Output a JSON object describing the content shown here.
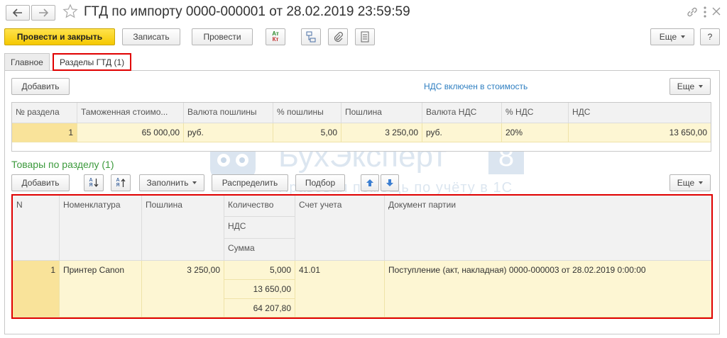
{
  "header": {
    "title": "ГТД по импорту 0000-000001 от 28.02.2019 23:59:59"
  },
  "toolbar": {
    "post_close": "Провести и закрыть",
    "save": "Записать",
    "post": "Провести",
    "dtkt_top": "Ат",
    "dtkt_bottom": "Кт",
    "more": "Еще",
    "help": "?"
  },
  "tabs": [
    {
      "label": "Главное"
    },
    {
      "label": "Разделы ГТД (1)"
    }
  ],
  "sections": {
    "add": "Добавить",
    "vat_link": "НДС включен в стоимость",
    "more": "Еще",
    "columns": [
      "№ раздела",
      "Таможенная стоимо...",
      "Валюта пошлины",
      "% пошлины",
      "Пошлина",
      "Валюта НДС",
      "% НДС",
      "НДС"
    ],
    "rows": [
      [
        "1",
        "65 000,00",
        "руб.",
        "5,00",
        "3 250,00",
        "руб.",
        "20%",
        "13 650,00"
      ]
    ]
  },
  "goods": {
    "title": "Товары по разделу (1)",
    "add": "Добавить",
    "sort_label": "АЯ",
    "fill": "Заполнить",
    "distribute": "Распределить",
    "pick": "Подбор",
    "more": "Еще",
    "columns": {
      "n": "N",
      "item": "Номенклатура",
      "duty": "Пошлина",
      "qty": "Количество",
      "vat": "НДС",
      "sum": "Сумма",
      "account": "Счет учета",
      "batch": "Документ партии"
    },
    "rows": [
      {
        "n": "1",
        "item": "Принтер Canon",
        "duty": "3 250,00",
        "qty": "5,000",
        "vat": "13 650,00",
        "sum": "64 207,80",
        "account": "41.01",
        "batch": "Поступление (акт, накладная) 0000-000003 от 28.02.2019 0:00:00"
      }
    ]
  },
  "watermark": {
    "brand": "БухЭксперт",
    "digit": "8",
    "slogan": "Правовая помощь по учёту в 1С"
  },
  "colors": {
    "primary_button": "#f5c800",
    "highlight": "#e00000",
    "link": "#2f7fc1",
    "section_title": "#3c9a3c",
    "selected_row": "#fdf6d3"
  }
}
